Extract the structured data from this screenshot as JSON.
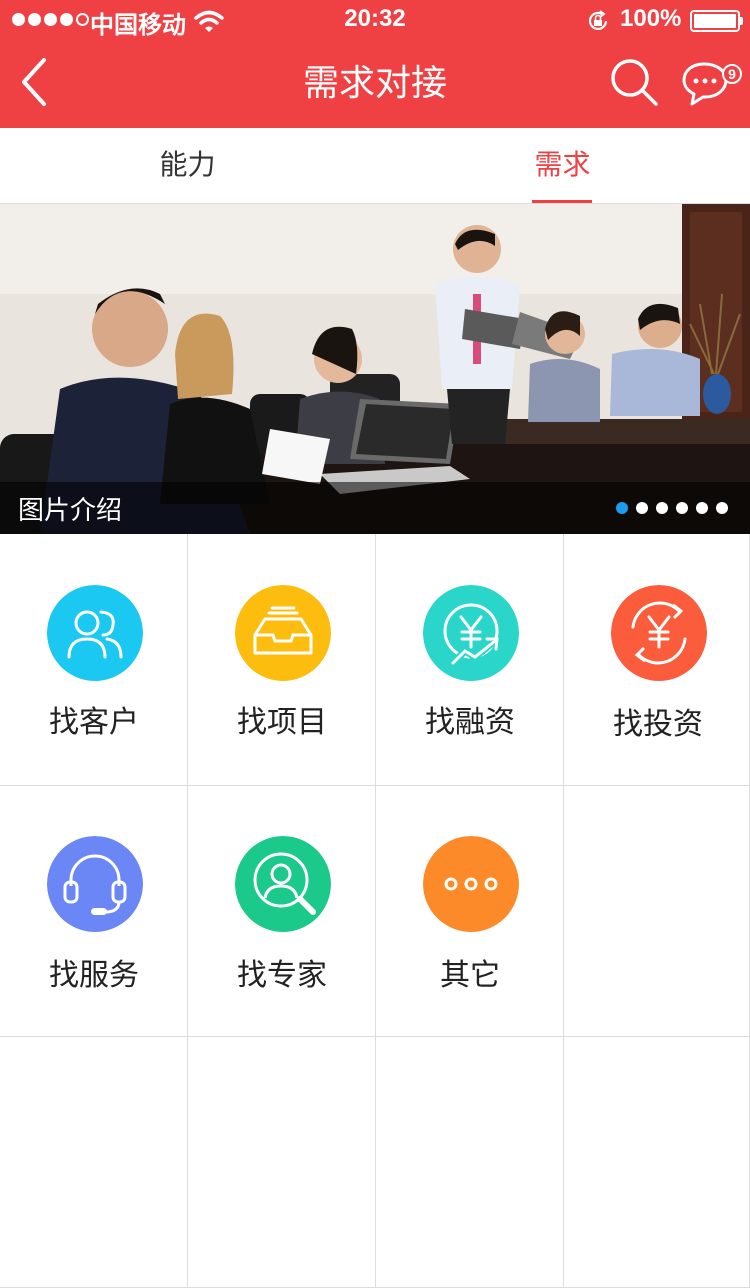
{
  "status_bar": {
    "carrier": "中国移动",
    "time": "20:32",
    "battery": "100%"
  },
  "nav": {
    "title": "需求对接",
    "message_badge": "9"
  },
  "tabs": [
    {
      "label": "能力",
      "active": false
    },
    {
      "label": "需求",
      "active": true
    }
  ],
  "banner": {
    "caption": "图片介绍",
    "dots_total": 6,
    "dots_active_index": 0
  },
  "grid": {
    "items": [
      {
        "label": "找客户",
        "icon": "customers-icon",
        "color": "#1bc8f2"
      },
      {
        "label": "找项目",
        "icon": "project-tray-icon",
        "color": "#fcbd0f"
      },
      {
        "label": "找融资",
        "icon": "financing-yen-icon",
        "color": "#2ad6c9"
      },
      {
        "label": "找投资",
        "icon": "investment-yen-icon",
        "color": "#fa5c3c"
      },
      {
        "label": "找服务",
        "icon": "headset-icon",
        "color": "#6b86f5"
      },
      {
        "label": "找专家",
        "icon": "expert-search-icon",
        "color": "#1bc98a"
      },
      {
        "label": "其它",
        "icon": "more-icon",
        "color": "#fd8a28"
      }
    ]
  },
  "colors": {
    "brand_red": "#ef4043",
    "active_dot": "#1a9cf0"
  }
}
